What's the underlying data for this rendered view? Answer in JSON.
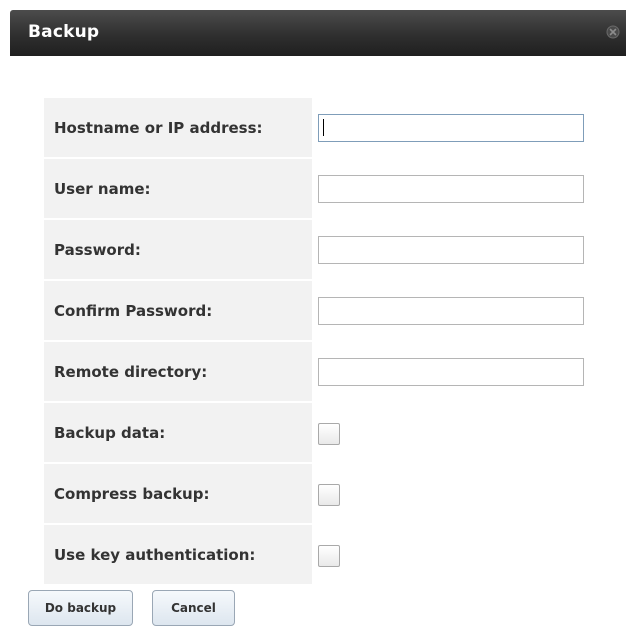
{
  "dialog": {
    "title": "Backup",
    "close_icon": "close-icon"
  },
  "form": {
    "hostname_label": "Hostname or IP address:",
    "hostname_value": "",
    "username_label": "User name:",
    "username_value": "",
    "password_label": "Password:",
    "password_value": "",
    "confirm_password_label": "Confirm Password:",
    "confirm_password_value": "",
    "remote_directory_label": "Remote directory:",
    "remote_directory_value": "",
    "backup_data_label": "Backup data:",
    "backup_data_checked": false,
    "compress_backup_label": "Compress backup:",
    "compress_backup_checked": false,
    "use_key_auth_label": "Use key authentication:",
    "use_key_auth_checked": false
  },
  "buttons": {
    "do_backup_label": "Do backup",
    "cancel_label": "Cancel"
  },
  "colors": {
    "titlebar": "#2f2f2f",
    "label_background": "#f2f2f2",
    "button_border": "#9aa7b5"
  }
}
